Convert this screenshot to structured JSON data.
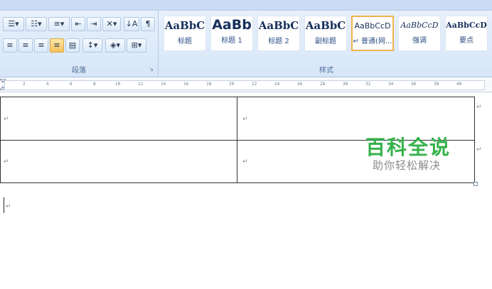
{
  "ribbon": {
    "paragraph_group_label": "段落",
    "styles_group_label": "样式",
    "styles": [
      {
        "sample": "AaBbC",
        "name": "标题"
      },
      {
        "sample": "AaBb",
        "name": "标题 1"
      },
      {
        "sample": "AaBbC",
        "name": "标题 2"
      },
      {
        "sample": "AaBbC",
        "name": "副标题"
      },
      {
        "sample": "AaBbCcD",
        "name": "↵ 普通(网..."
      },
      {
        "sample": "AaBbCcD",
        "name": "强调"
      },
      {
        "sample": "AaBbCcD",
        "name": "要点"
      }
    ],
    "icons": {
      "sort": "sort-az-icon",
      "show_marks": "paragraph-mark-icon",
      "shading": "shading-bucket-icon",
      "borders": "borders-icon"
    }
  },
  "ruler": {
    "ticks": [
      "2",
      "4",
      "6",
      "8",
      "10",
      "12",
      "14",
      "16",
      "18",
      "20",
      "22",
      "24",
      "26",
      "28",
      "30",
      "32",
      "34",
      "36",
      "38",
      "40"
    ]
  },
  "document": {
    "cell_mark": "↵",
    "paragraph_mark": "↵"
  },
  "watermark": {
    "title": "百科全说",
    "subtitle": "助你轻松解决"
  }
}
